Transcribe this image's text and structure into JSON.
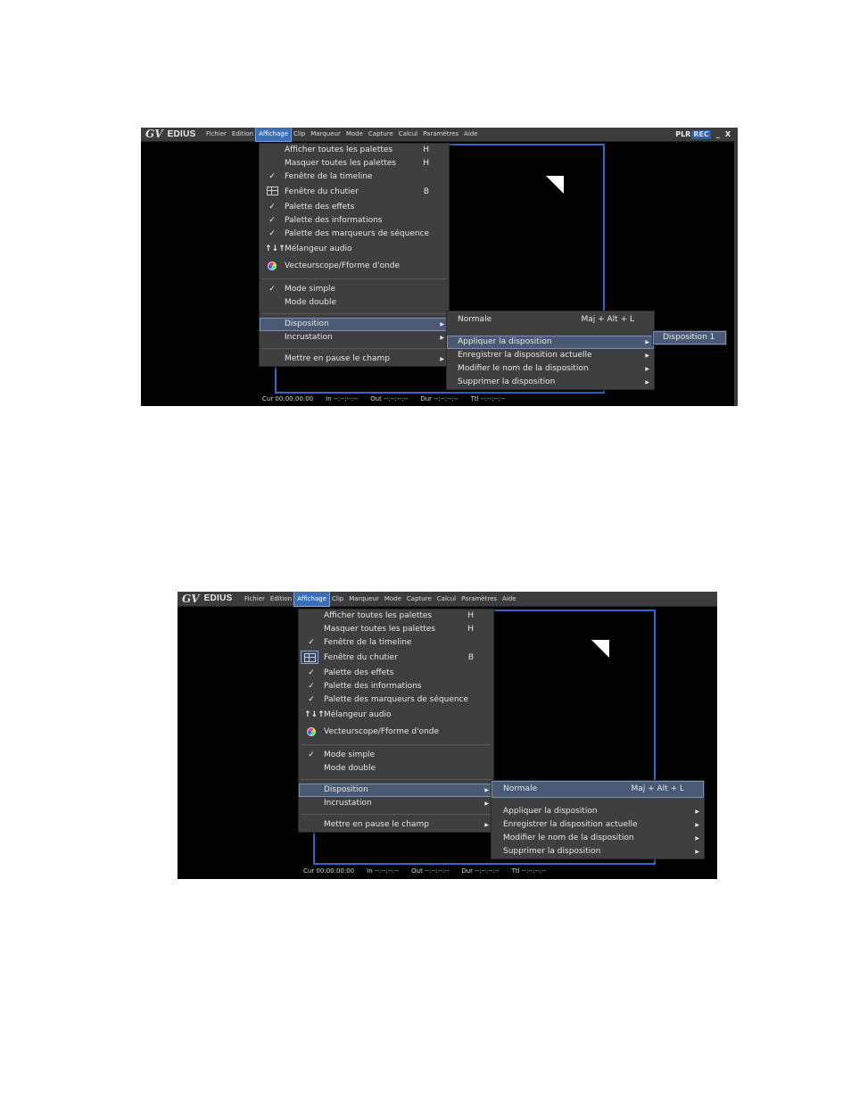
{
  "app": {
    "logo_mark": "GV",
    "logo_text": "EDIUS",
    "menus": [
      "Fichier",
      "Edition",
      "Affichage",
      "Clip",
      "Marqueur",
      "Mode",
      "Capture",
      "Calcul",
      "Paramètres",
      "Aide"
    ],
    "plr": "PLR",
    "rec": "REC",
    "minimize": "_",
    "close": "X"
  },
  "status_bar": {
    "cur": "Cur 00:00:00:00",
    "in": "In --:--:--:--",
    "out": "Out --:--:--:--",
    "dur": "Dur --:--:--:--",
    "ttl": "Ttl --:--:--:--"
  },
  "affichage_menu": {
    "items": [
      {
        "label": "Afficher toutes les palettes",
        "shortcut": "H"
      },
      {
        "label": "Masquer toutes les palettes",
        "shortcut": "H"
      },
      {
        "label": "Fenêtre de la timeline",
        "check": "✓"
      },
      {
        "label": "Fenêtre du chutier",
        "shortcut": "B",
        "icon": "chutier"
      },
      {
        "label": "Palette des effets",
        "check": "✓"
      },
      {
        "label": "Palette des informations",
        "check": "✓"
      },
      {
        "label": "Palette des marqueurs de séquence",
        "check": "✓"
      },
      {
        "label": "Mélangeur audio",
        "icon": "mixer"
      },
      {
        "label": "Vecteurscope/Fforme d'onde",
        "icon": "vector"
      },
      {
        "label": "Mode simple",
        "check": "✓"
      },
      {
        "label": "Mode double"
      },
      {
        "label": "Disposition"
      },
      {
        "label": "Incrustation"
      },
      {
        "label": "Mettre en pause le champ"
      }
    ],
    "mixer_glyph": "↑↓↑"
  },
  "disposition_menu": {
    "normale": {
      "label": "Normale",
      "shortcut_1": "Maj + Alt + L",
      "shortcut_2": "Maj + Alt + L"
    },
    "items": [
      {
        "label": "Appliquer la disposition"
      },
      {
        "label": "Enregistrer la disposition actuelle"
      },
      {
        "label": "Modifier le nom de la disposition"
      },
      {
        "label": "Supprimer la disposition"
      }
    ]
  },
  "apply_submenu": {
    "items": [
      {
        "label": "Disposition 1"
      }
    ]
  }
}
